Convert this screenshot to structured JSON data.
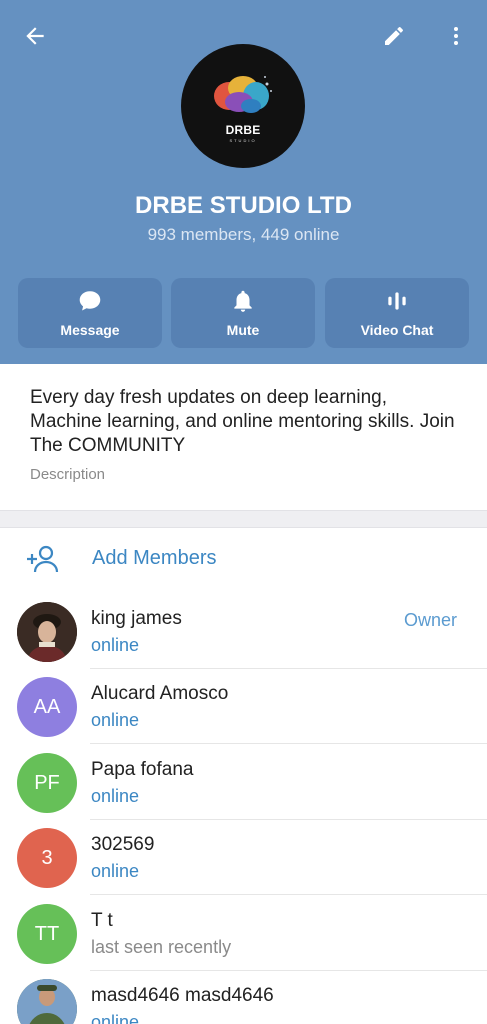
{
  "header": {
    "back_icon": "arrow-left-icon",
    "edit_icon": "pencil-icon",
    "more_icon": "more-vertical-icon",
    "avatar_logo": {
      "main": "DRBE",
      "sub": "STUDIO"
    },
    "title": "DRBE STUDIO LTD",
    "subtitle": "993 members, 449 online",
    "color": "#6591c1"
  },
  "actions": [
    {
      "label": "Message",
      "icon": "chat-bubble-icon"
    },
    {
      "label": "Mute",
      "icon": "bell-icon"
    },
    {
      "label": "Video Chat",
      "icon": "voice-bars-icon"
    }
  ],
  "description": {
    "text": "Every day fresh updates on deep learning, Machine learning, and online mentoring skills. Join The COMMUNITY",
    "label": "Description"
  },
  "add_members": {
    "label": "Add Members",
    "icon": "add-person-icon",
    "color": "#3c87c3"
  },
  "members": [
    {
      "name": "king james",
      "status": "online",
      "role": "Owner",
      "avatar_type": "photo"
    },
    {
      "name": "Alucard Amosco",
      "status": "online",
      "initials": "AA",
      "avatar_color": "#8e7fe0"
    },
    {
      "name": "Papa fofana",
      "status": "online",
      "initials": "PF",
      "avatar_color": "#66c058"
    },
    {
      "name": "302569",
      "status": "online",
      "initials": "3",
      "avatar_color": "#e0644f"
    },
    {
      "name": "T t",
      "status": "last seen recently",
      "initials": "TT",
      "avatar_color": "#66c058"
    },
    {
      "name": "masd4646 masd4646",
      "status": "online",
      "avatar_type": "photo"
    }
  ]
}
